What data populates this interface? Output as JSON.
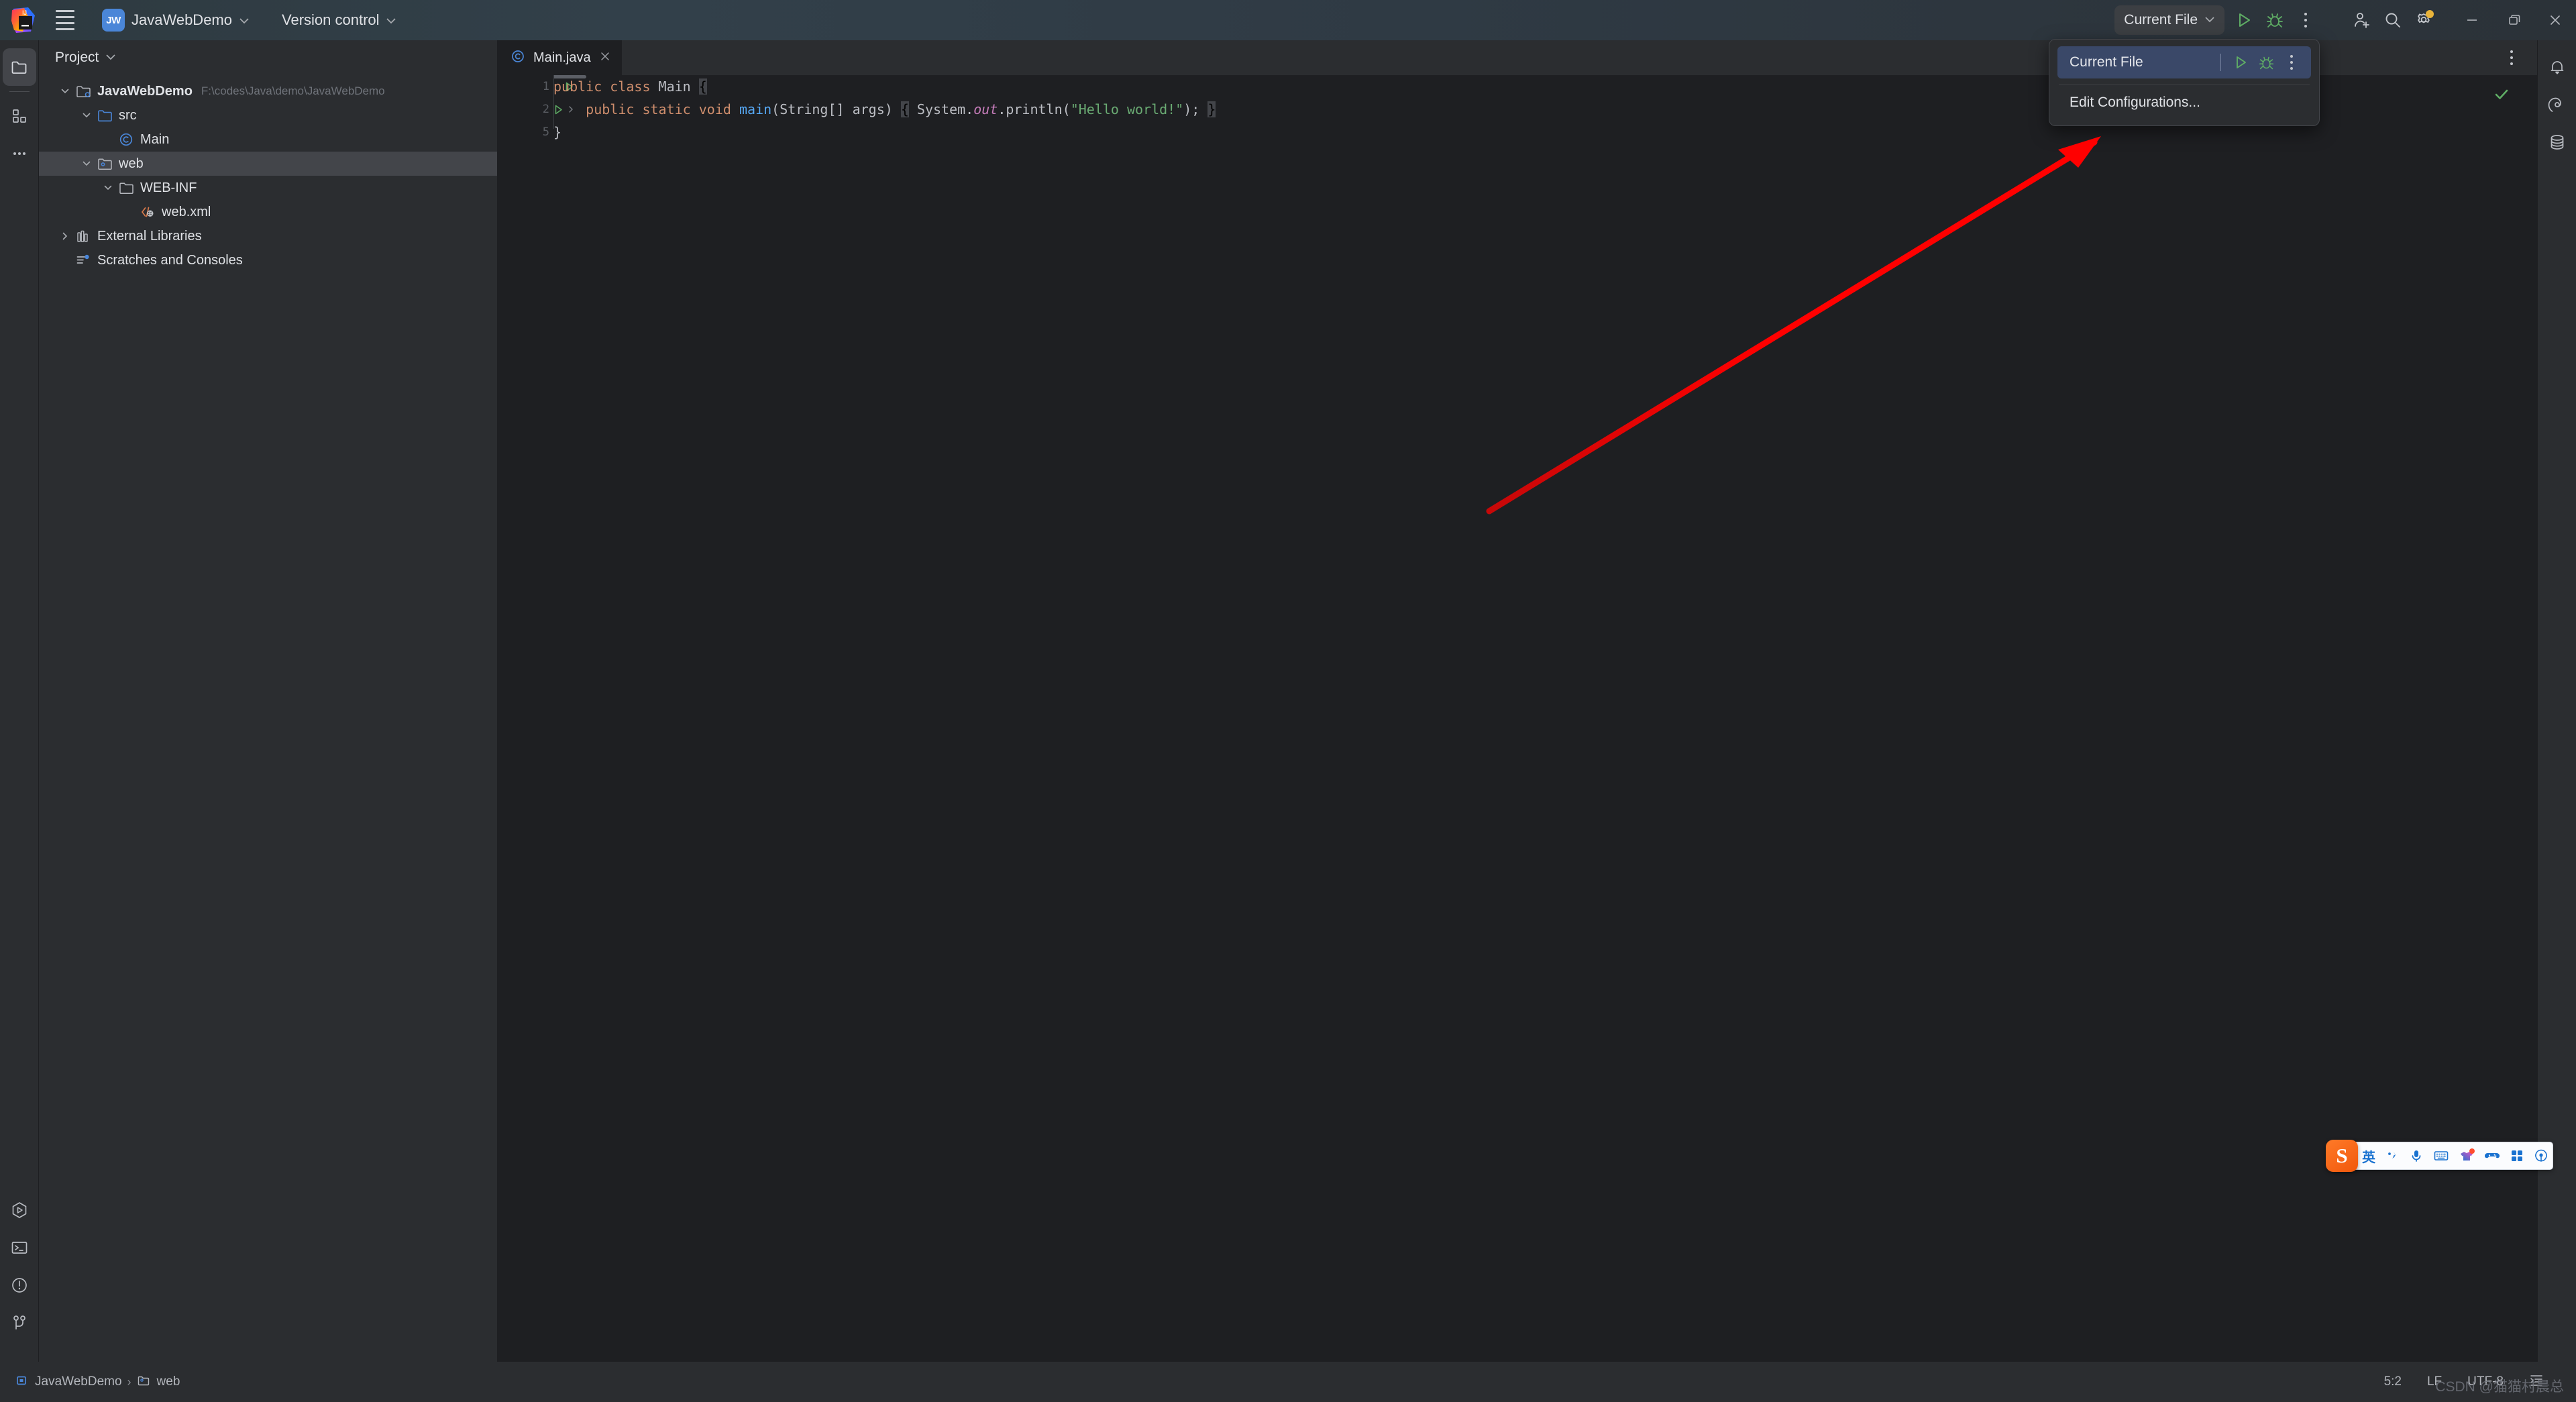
{
  "titlebar": {
    "app_logo": "intellij-idea-logo",
    "menu_icon": "hamburger-menu-icon",
    "project_badge": "JW",
    "project_name": "JavaWebDemo",
    "vcs_label": "Version control",
    "run_config_label": "Current File",
    "run_icon": "run-icon",
    "debug_icon": "debug-icon",
    "more_icon": "more-vertical-icon",
    "account_icon": "add-account-icon",
    "search_icon": "search-icon",
    "settings_icon": "gear-icon",
    "minimize_icon": "minimize-icon",
    "maximize_icon": "maximize-icon",
    "close_icon": "close-icon"
  },
  "left_activity_bar": {
    "top_items": [
      {
        "name": "project-tool-window",
        "icon": "folder-icon",
        "selected": true
      },
      {
        "name": "structure-tool-window",
        "icon": "structure-icon",
        "selected": false
      },
      {
        "name": "more-tool-windows",
        "icon": "more-horizontal-icon",
        "selected": false
      }
    ],
    "bottom_items": [
      {
        "name": "run-tool-window",
        "icon": "run-hexagon-icon"
      },
      {
        "name": "terminal-tool-window",
        "icon": "terminal-icon"
      },
      {
        "name": "problems-tool-window",
        "icon": "warning-circle-icon"
      },
      {
        "name": "version-control-tool-window",
        "icon": "git-branch-icon"
      }
    ]
  },
  "right_activity_bar": {
    "items": [
      {
        "name": "notifications",
        "icon": "bell-icon"
      },
      {
        "name": "ai-assistant",
        "icon": "spiral-icon"
      },
      {
        "name": "database",
        "icon": "database-icon"
      }
    ]
  },
  "project_panel": {
    "title": "Project",
    "chevron": "chevron-down-icon",
    "tree": [
      {
        "label": "JavaWebDemo",
        "path": "F:\\codes\\Java\\demo\\JavaWebDemo",
        "icon": "project-module-icon",
        "indent": 0,
        "twisty": "expanded",
        "bold": true,
        "selected": false
      },
      {
        "label": "src",
        "path": "",
        "icon": "source-folder-icon",
        "indent": 1,
        "twisty": "expanded",
        "bold": false,
        "selected": false
      },
      {
        "label": "Main",
        "path": "",
        "icon": "java-class-icon",
        "indent": 2,
        "twisty": "none",
        "bold": false,
        "selected": false
      },
      {
        "label": "web",
        "path": "",
        "icon": "web-folder-icon",
        "indent": 1,
        "twisty": "expanded",
        "bold": false,
        "selected": true
      },
      {
        "label": "WEB-INF",
        "path": "",
        "icon": "folder-icon",
        "indent": 2,
        "twisty": "expanded",
        "bold": false,
        "selected": false
      },
      {
        "label": "web.xml",
        "path": "",
        "icon": "xml-file-icon",
        "indent": 3,
        "twisty": "none",
        "bold": false,
        "selected": false
      },
      {
        "label": "External Libraries",
        "path": "",
        "icon": "libraries-icon",
        "indent": 0,
        "twisty": "collapsed",
        "bold": false,
        "selected": false
      },
      {
        "label": "Scratches and Consoles",
        "path": "",
        "icon": "scratches-icon",
        "indent": 0,
        "twisty": "none",
        "bold": false,
        "selected": false
      }
    ]
  },
  "editor": {
    "tabs": [
      {
        "label": "Main.java",
        "icon": "java-class-icon",
        "active": true,
        "close_icon": "close-icon"
      }
    ],
    "tabbar_more_icon": "more-vertical-icon",
    "inspection_status_icon": "check-ok-icon",
    "gutter_numbers": [
      "1",
      "2",
      "5"
    ],
    "code_lines": [
      {
        "num": "1",
        "runmark": true,
        "fold": false,
        "tokens": [
          {
            "t": "public ",
            "c": "kw"
          },
          {
            "t": "class ",
            "c": "kw"
          },
          {
            "t": "Main ",
            "c": "cls"
          },
          {
            "t": "{",
            "c": "hl"
          }
        ]
      },
      {
        "num": "2",
        "runmark": true,
        "fold": true,
        "tokens": [
          {
            "t": "    ",
            "c": "pln"
          },
          {
            "t": "public ",
            "c": "kw"
          },
          {
            "t": "static ",
            "c": "kw"
          },
          {
            "t": "void ",
            "c": "kw"
          },
          {
            "t": "main",
            "c": "mth"
          },
          {
            "t": "(String[] args) ",
            "c": "pln"
          },
          {
            "t": "{",
            "c": "hl"
          },
          {
            "t": " System.",
            "c": "pln"
          },
          {
            "t": "out",
            "c": "fld"
          },
          {
            "t": ".println(",
            "c": "pln"
          },
          {
            "t": "\"Hello world!\"",
            "c": "str"
          },
          {
            "t": "); ",
            "c": "pln"
          },
          {
            "t": "}",
            "c": "hl"
          }
        ]
      },
      {
        "num": "5",
        "runmark": false,
        "fold": false,
        "tokens": [
          {
            "t": "}",
            "c": "brc"
          }
        ]
      }
    ]
  },
  "run_config_popup": {
    "selected": {
      "label": "Current File",
      "run_icon": "run-icon",
      "debug_icon": "debug-icon",
      "more_icon": "more-vertical-icon"
    },
    "items": [
      {
        "label": "Edit Configurations...",
        "name": "edit-configurations"
      }
    ]
  },
  "status_bar": {
    "breadcrumb": [
      {
        "label": "JavaWebDemo",
        "icon": "module-icon"
      },
      {
        "label": "web",
        "icon": "web-folder-icon"
      }
    ],
    "separator": "›",
    "caret_position": "5:2",
    "line_separator": "LF",
    "encoding": "UTF-8",
    "indent_icon": "indent-icon"
  },
  "ime_toolbar": {
    "logo": "S",
    "items": [
      {
        "name": "language-mode",
        "glyph": "英"
      },
      {
        "name": "punctuation-mode",
        "icon": "punctuation-icon"
      },
      {
        "name": "voice-input",
        "icon": "microphone-icon"
      },
      {
        "name": "soft-keyboard",
        "icon": "keyboard-icon"
      },
      {
        "name": "skin-store",
        "icon": "skin-icon"
      },
      {
        "name": "games",
        "icon": "gamepad-icon"
      },
      {
        "name": "toolbox",
        "icon": "grid-icon"
      },
      {
        "name": "settings",
        "icon": "sogou-settings-icon"
      }
    ]
  },
  "annotation": {
    "arrow_color": "#ff0000",
    "name": "red-arrow-pointing-to-run-config-dropdown"
  },
  "watermark": {
    "text": "CSDN @猫猫村晨总"
  },
  "colors": {
    "background": "#1e1f22",
    "panel": "#2b2d30",
    "selection": "#43454a",
    "popup_selected": "#3a4868",
    "accent_blue": "#4a86d8",
    "run_green": "#5fad65",
    "string_green": "#6aab73",
    "keyword_orange": "#cf8e6d",
    "method_blue": "#56a8f5"
  }
}
